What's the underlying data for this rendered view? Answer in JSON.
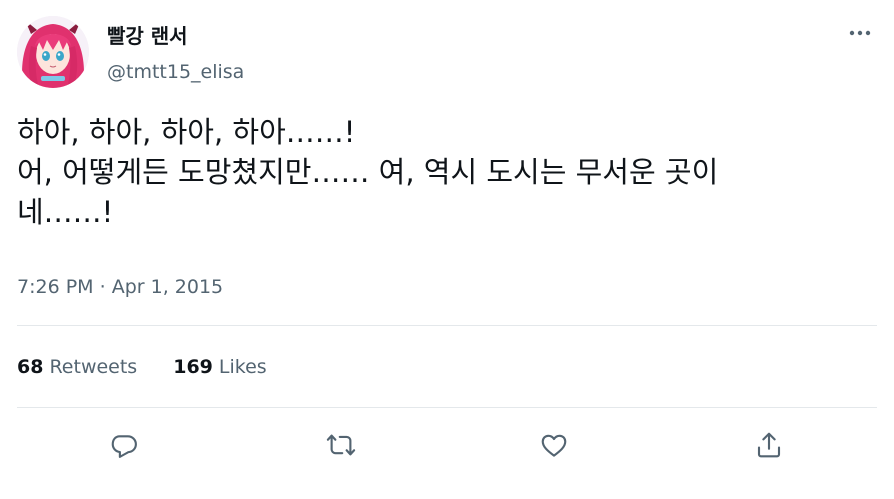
{
  "author": {
    "display_name": "빨강 랜서",
    "handle": "@tmtt15_elisa"
  },
  "tweet": {
    "lines": [
      "하아, 하아, 하아, 하아……!",
      "어, 어떻게든 도망쳤지만…… 여, 역시 도시는 무서운 곳이",
      "네……!"
    ],
    "time": "7:26 PM",
    "separator": "·",
    "date": "Apr 1, 2015"
  },
  "stats": {
    "retweets_count": "68",
    "retweets_label": "Retweets",
    "likes_count": "169",
    "likes_label": "Likes"
  },
  "icons": {
    "more": "more-icon",
    "reply": "reply-icon",
    "retweet": "retweet-icon",
    "like": "like-icon",
    "share": "share-icon"
  },
  "colors": {
    "text_primary": "#0f1419",
    "text_secondary": "#536471",
    "divider": "#e4e8eb"
  }
}
